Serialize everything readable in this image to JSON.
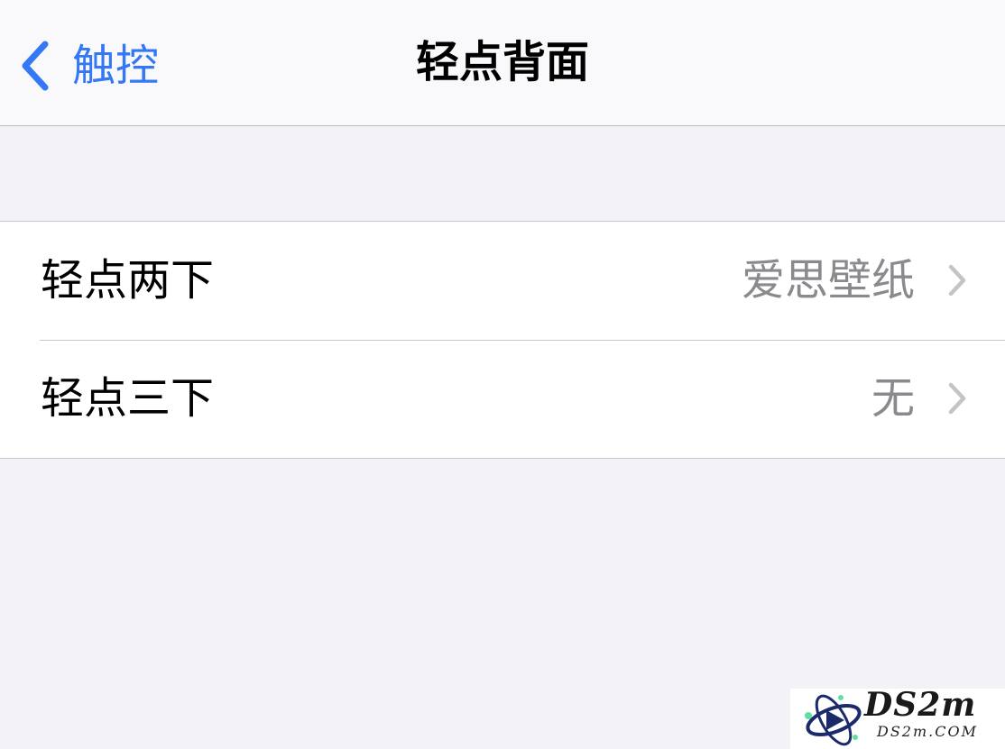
{
  "navbar": {
    "back_label": "触控",
    "title": "轻点背面"
  },
  "rows": [
    {
      "label": "轻点两下",
      "value": "爱思壁纸"
    },
    {
      "label": "轻点三下",
      "value": "无"
    }
  ],
  "watermark": {
    "brand": "DS2m",
    "site": "DS2m.COM"
  },
  "colors": {
    "accent": "#3478f6",
    "background": "#f2f2f7",
    "cell": "#ffffff",
    "value_text": "#8a8a8e",
    "chevron": "#c4c4c7",
    "separator": "#c8c8cc"
  },
  "icons": {
    "back": "chevron-left-icon",
    "disclosure": "chevron-right-icon",
    "watermark_logo": "orbit-logo-icon"
  }
}
